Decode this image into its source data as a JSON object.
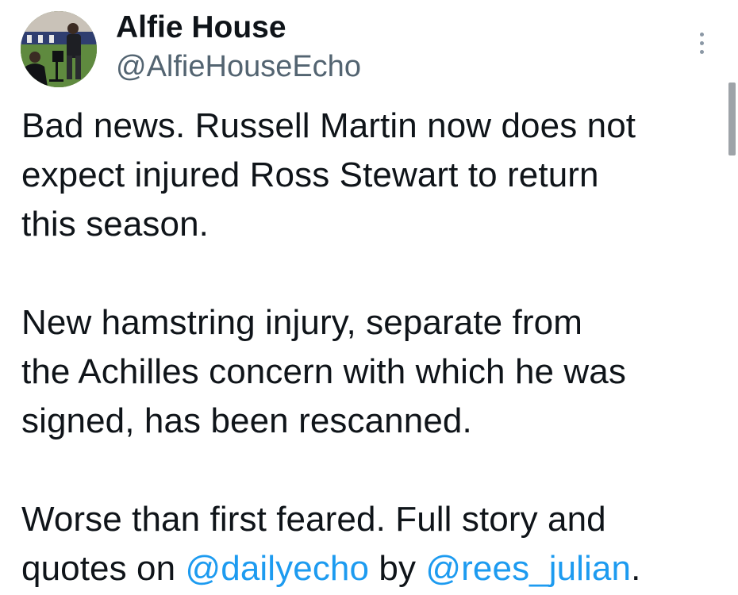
{
  "tweet": {
    "author": {
      "name": "Alfie House",
      "handle": "@AlfieHouseEcho"
    },
    "paragraphs": [
      [
        "Bad news. Russell Martin now does not",
        "expect injured Ross Stewart to return",
        "this season."
      ],
      [
        "New hamstring injury, separate from",
        "the Achilles concern with which he was",
        "signed, has been rescanned."
      ]
    ],
    "final_paragraph": {
      "line1": "Worse than first feared. Full story and",
      "prefix": "quotes on ",
      "mention1": "@dailyecho",
      "middle": " by ",
      "mention2": "@rees_julian",
      "suffix": "."
    }
  },
  "icons": {
    "more": "vertical-ellipsis-icon",
    "avatar": "profile-photo"
  },
  "colors": {
    "text": "#0f1419",
    "secondary_text": "#536471",
    "link": "#1d9bf0"
  }
}
